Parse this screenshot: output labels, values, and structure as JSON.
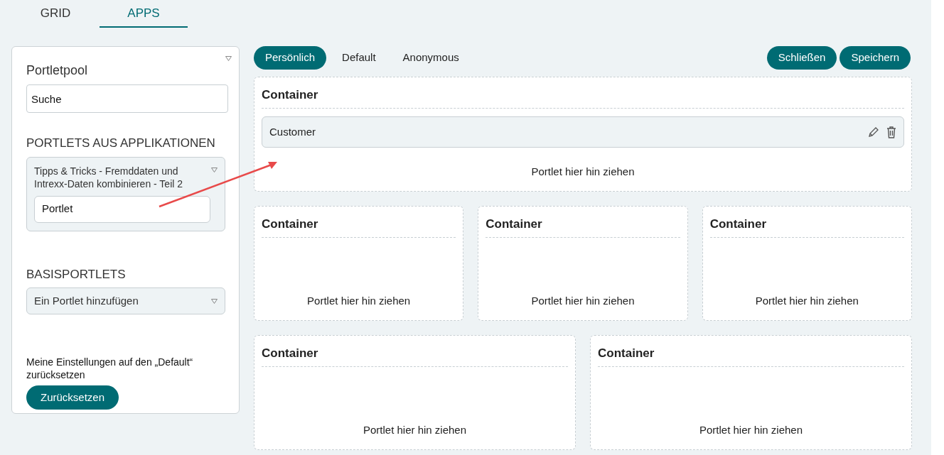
{
  "tabs": [
    {
      "label": "GRID",
      "selected": false
    },
    {
      "label": "APPS",
      "selected": true
    }
  ],
  "sidebar": {
    "title": "Portletpool",
    "search": {
      "value": "Suche"
    },
    "apps_section": {
      "heading": "PORTLETS AUS APPLIKATIONEN",
      "dropdown": "Tipps & Tricks - Fremddaten und Intrexx-Daten kombinieren - Teil 2",
      "item": "Portlet"
    },
    "basic_section": {
      "heading": "BASISPORTLETS",
      "dropdown": "Ein Portlet hinzufügen"
    },
    "reset_text": "Meine Einstellungen auf den „Default“ zurücksetzen",
    "reset_button": "Zurücksetzen"
  },
  "view_tabs": [
    {
      "label": "Persönlich",
      "selected": true
    },
    {
      "label": "Default",
      "selected": false
    },
    {
      "label": "Anonymous",
      "selected": false
    }
  ],
  "actions": [
    "Schließen",
    "Speichern"
  ],
  "rows": [
    {
      "containers": [
        {
          "title": "Container",
          "portlets": [
            "Customer"
          ],
          "drop_hint": "Portlet hier hin ziehen"
        }
      ]
    },
    {
      "containers": [
        {
          "title": "Container",
          "drop_hint": "Portlet hier hin ziehen"
        },
        {
          "title": "Container",
          "drop_hint": "Portlet hier hin ziehen"
        },
        {
          "title": "Container",
          "drop_hint": "Portlet hier hin ziehen"
        }
      ]
    },
    {
      "containers": [
        {
          "title": "Container",
          "drop_hint": "Portlet hier hin ziehen"
        },
        {
          "title": "Container",
          "drop_hint": "Portlet hier hin ziehen"
        }
      ]
    }
  ]
}
